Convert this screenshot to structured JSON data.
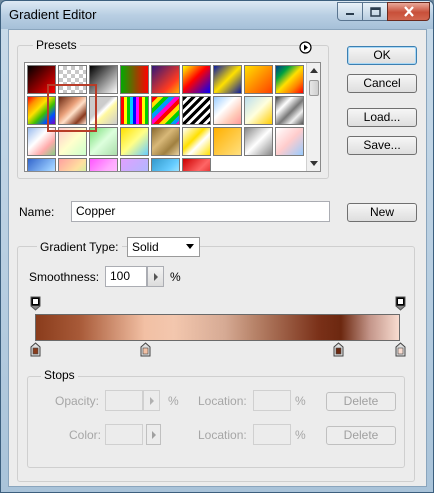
{
  "window": {
    "title": "Gradient Editor"
  },
  "presets": {
    "legend": "Presets",
    "swatches": [
      "linear-gradient(135deg,#000,#f00)",
      "repeating-conic-gradient(#c8c8c8 0 25%,#fff 0 50%) 0 0/8px 8px",
      "linear-gradient(135deg,#000,#fff)",
      "linear-gradient(90deg,#0a0,#f00)",
      "linear-gradient(135deg,#301878,#ff3a20 70%,#ffb000)",
      "linear-gradient(135deg,#ff0 0%,#f00 45%,#00f 100%)",
      "linear-gradient(135deg,#0a1aa0 0%,#ffe000 50%,#0a1aa0 100%)",
      "linear-gradient(135deg,#ffe000,#ff4000)",
      "linear-gradient(135deg,#003a8c,#00a040,#ffe000,#ff8000,#f00)",
      "linear-gradient(135deg,#ff0000,#ff9000,#ffe000,#40c000,#0050ff,#8000c0)",
      "linear-gradient(135deg,#6a2a14,#e9a07a 40%,#ffe0c8 55%,#8a3a1e 80%,#ffe4d2)",
      "linear-gradient(135deg,#ccc 40%,#fff 50%,#fff8a0 60%,#ccc)",
      "repeating-linear-gradient(90deg,#f00 0 3px,#ff0 3px 6px,#0c0 6px 9px,#0cf 9px 12px,#00f 12px 15px,#f0f 15px 18px)",
      "repeating-linear-gradient(135deg,#f00 0 4px,#ffe000 4px 8px,#0c0 8px 12px,#09f 12px 16px,#f0c 16px 20px)",
      "repeating-linear-gradient(135deg,#000 0 3px,#fff 3px 6px)",
      "linear-gradient(135deg,#9cf,#fff 40%,#fcb 70%,#f99)",
      "linear-gradient(135deg,#bde 0%,#ffd 50%,#fc0 100%)",
      "linear-gradient(135deg,#444,#fff 30%,#777 55%,#eee 75%,#555)",
      "linear-gradient(135deg,#9be 0%,#fff 40%,#faa 70%,#8c8)",
      "linear-gradient(135deg,#fcc,#ffc 50%,#cfc)",
      "linear-gradient(135deg,#7d7,#dfd 50%,#ada)",
      "linear-gradient(135deg,#ffe000,#ff8 50%,#6cf)",
      "linear-gradient(135deg,#8a6a30,#d8b878 40%,#a08040 70%,#e8d0a0)",
      "linear-gradient(135deg,#fff,#ffe000 40%,#fff 60%,#ffe000)",
      "linear-gradient(135deg,#ffb000,#ffe080)",
      "linear-gradient(135deg,#888,#fff 50%,#888)",
      "linear-gradient(135deg,#fff,#fcc 50%,#9cf)",
      "linear-gradient(135deg,#36c,#9cf 60%,#fff)",
      "linear-gradient(135deg,#ffa0a0,#ffe0a0 50%,#a0ffa0)",
      "linear-gradient(135deg,#f5f,#faf 50%,#fcf)",
      "linear-gradient(135deg,#e0a0ff,#a0c0ff)",
      "linear-gradient(135deg,#39c,#6cf 50%,#dff)",
      "linear-gradient(135deg,#c00,#f66 50%,#c00)"
    ]
  },
  "buttons": {
    "ok": "OK",
    "cancel": "Cancel",
    "load": "Load...",
    "save": "Save...",
    "new": "New",
    "delete_opacity": "Delete",
    "delete_color": "Delete"
  },
  "name_field": {
    "label": "Name:",
    "value": "Copper"
  },
  "gradient_type": {
    "label": "Gradient Type:",
    "value": "Solid"
  },
  "smoothness": {
    "label": "Smoothness:",
    "value": "100",
    "unit": "%"
  },
  "gradient": {
    "fill": "linear-gradient(90deg,#8a3c1c 0%,#a85a38 12%,#f2c0a4 30%,#f3c7ae 38%,#d6aa94 52%,#b8846a 60%,#7a3018 78%,#6c2810 84%,#c4968a 92%,#f8dcd0 100%)",
    "opacity_stops": [
      0,
      100
    ],
    "color_stops": [
      {
        "position": 0,
        "color": "#8a3c1c"
      },
      {
        "position": 30,
        "color": "#f2c0a4"
      },
      {
        "position": 83,
        "color": "#6c2810"
      },
      {
        "position": 100,
        "color": "#f8dcd0"
      }
    ]
  },
  "stops": {
    "legend": "Stops",
    "opacity_label": "Opacity:",
    "opacity_unit": "%",
    "opacity_location_label": "Location:",
    "opacity_location_unit": "%",
    "color_label": "Color:",
    "color_location_label": "Location:",
    "color_location_unit": "%"
  }
}
